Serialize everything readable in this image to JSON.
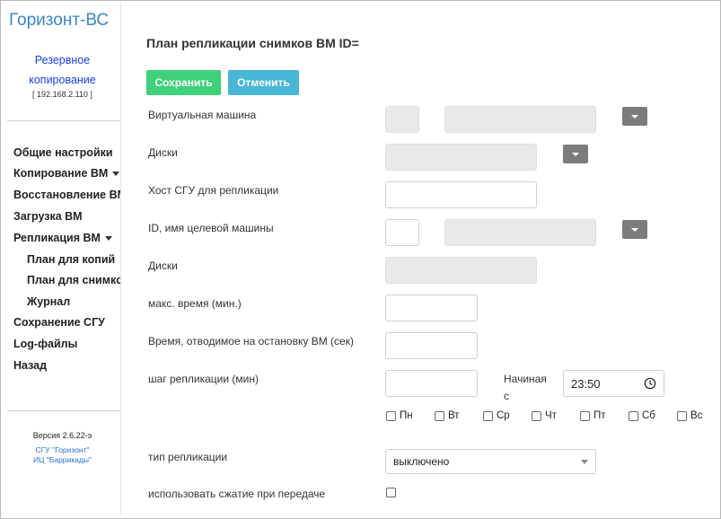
{
  "sidebar": {
    "brand": "Горизонт-ВС",
    "backup_link_line1": "Резервное",
    "backup_link_line2": "копирование",
    "ip": "[ 192.168.2.110 ]",
    "items": [
      {
        "label": "Общие настройки"
      },
      {
        "label": "Копирование ВМ"
      },
      {
        "label": "Восстановление ВМ"
      },
      {
        "label": "Загрузка ВМ"
      },
      {
        "label": "Репликация ВМ"
      },
      {
        "label": "План для копий"
      },
      {
        "label": "План для снимков"
      },
      {
        "label": "Журнал"
      },
      {
        "label": "Сохранение СГУ"
      },
      {
        "label": "Log-файлы"
      },
      {
        "label": "Назад"
      }
    ],
    "version": "Версия 2.6.22-э",
    "footer_line1": "СГУ \"Горизонт\"",
    "footer_line2": "ИЦ \"Баррикады\""
  },
  "main": {
    "title": "План репликации снимков ВМ ID=",
    "save_label": "Сохранить",
    "cancel_label": "Отменить",
    "labels": {
      "vm": "Виртуальная машина",
      "disks": "Диски",
      "host": "Хост СГУ для репликации",
      "target": "ID, имя целевой машины",
      "disks2": "Диски",
      "max_time": "макс. время (мин.)",
      "stop_time": "Время, отводимое на остановку ВМ (сек)",
      "step": "шаг репликации (мин)",
      "start": "Начиная с",
      "rep_type": "тип репликации",
      "compress": "использовать сжатие при передаче"
    },
    "start_time": "23:50",
    "days": [
      "Пн",
      "Вт",
      "Ср",
      "Чт",
      "Пт",
      "Сб",
      "Вс"
    ],
    "rep_type_value": "выключено"
  },
  "icons": {
    "clock": "clock-icon",
    "dropdown": "chevron-down-icon"
  },
  "colors": {
    "save": "#3fd07a",
    "cancel": "#48b6d6",
    "brand": "#3a86c8",
    "link": "#1a3ee8"
  }
}
